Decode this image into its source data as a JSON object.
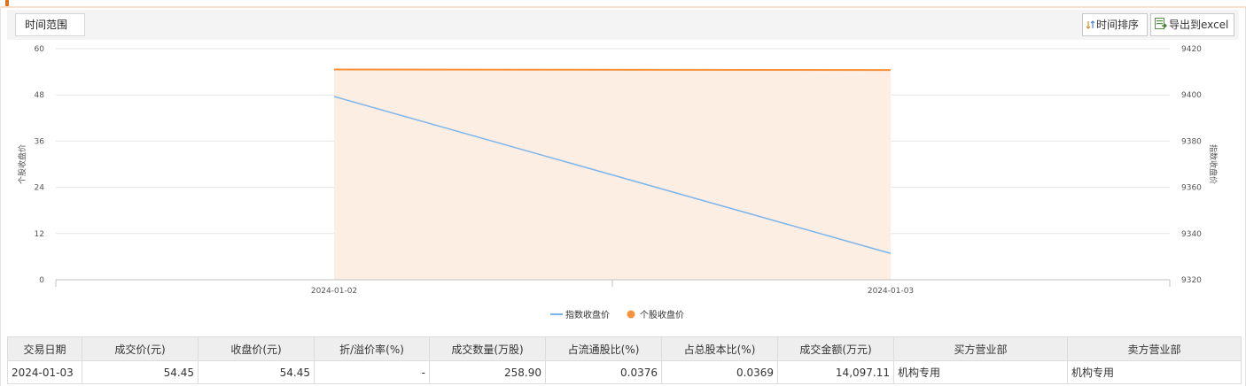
{
  "toolbar": {
    "range_label": "时间范围",
    "sort_label": "时间排序",
    "export_label": "导出到excel"
  },
  "chart_data": {
    "type": "line",
    "x": [
      "2024-01-02",
      "2024-01-03"
    ],
    "left_axis": {
      "label": "个股收盘价",
      "ticks": [
        "60",
        "48",
        "36",
        "24",
        "12",
        "0"
      ],
      "ylim": [
        0,
        60
      ]
    },
    "right_axis": {
      "label": "指数收盘价",
      "ticks": [
        "9420",
        "9400",
        "9380",
        "9360",
        "9340",
        "9320"
      ],
      "ylim": [
        9320,
        9420
      ]
    },
    "series": [
      {
        "name": "指数收盘价",
        "axis": "right",
        "color": "#7cb5ec",
        "values": [
          9399.3,
          9331.4
        ]
      },
      {
        "name": "个股收盘价",
        "axis": "left",
        "color": "#f7923a",
        "values": [
          54.6,
          54.45
        ],
        "area_fill": "#fdeee3"
      }
    ],
    "legend": "bottom-center",
    "grid": true
  },
  "table": {
    "headers": [
      "交易日期",
      "成交价(元)",
      "收盘价(元)",
      "折/溢价率(%)",
      "成交数量(万股)",
      "占流通股比(%)",
      "占总股本比(%)",
      "成交金额(万元)",
      "买方营业部",
      "卖方营业部"
    ],
    "rows": [
      [
        "2024-01-03",
        "54.45",
        "54.45",
        "-",
        "258.90",
        "0.0376",
        "0.0369",
        "14,097.11",
        "机构专用",
        "机构专用"
      ]
    ]
  }
}
